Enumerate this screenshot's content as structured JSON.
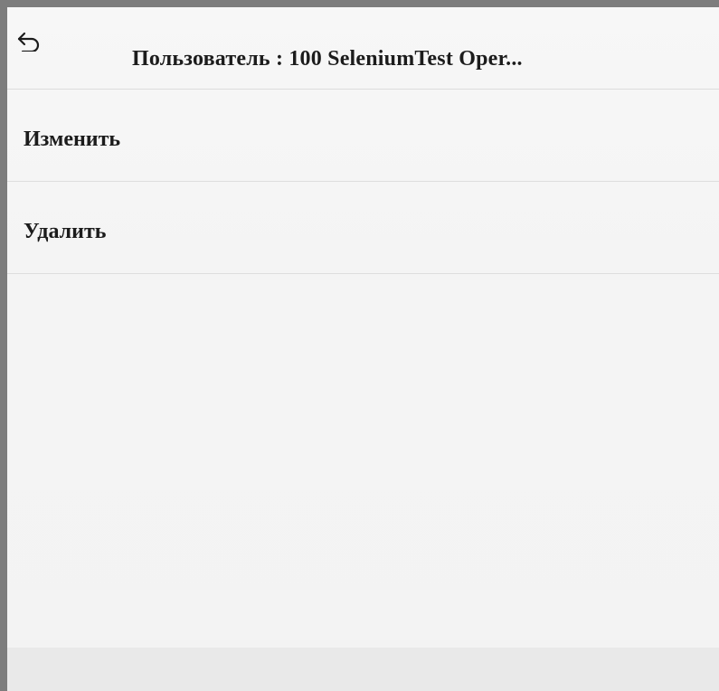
{
  "header": {
    "back_icon": "back-arrow-icon",
    "title": "Пользователь : 100 SeleniumTest Oper..."
  },
  "menu": {
    "items": [
      {
        "label": "Изменить"
      },
      {
        "label": "Удалить"
      }
    ]
  },
  "colors": {
    "frame": "#7d7d7d",
    "background": "#f5f5f5",
    "text": "#1c1c1c",
    "divider": "#dcdcdc"
  }
}
